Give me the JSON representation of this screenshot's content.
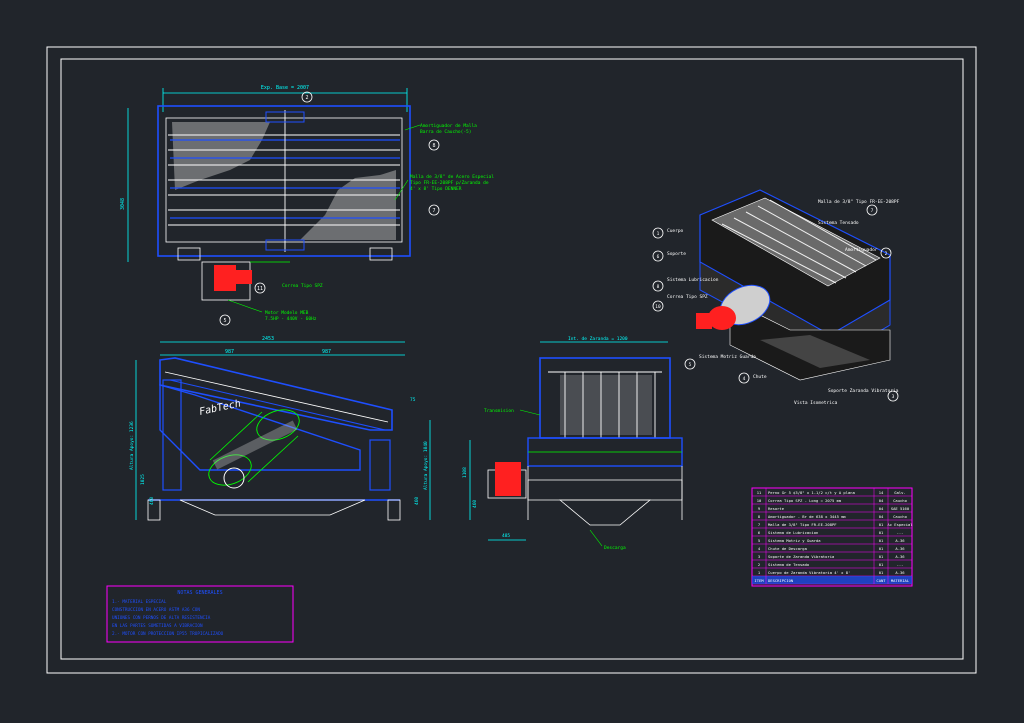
{
  "colors": {
    "background": "#21252b",
    "frame": "#ffffff",
    "geometry": "#1e4fff",
    "dimension": "#00ffff",
    "note": "#00ff00",
    "hatch": "#c8c8c8",
    "motor": "#ff2020",
    "table": "#ff00ff",
    "label": "#ffffff",
    "dark": "#101010"
  },
  "top_view": {
    "dim_width": "Exp. Base = 2007",
    "dim_height": "3048",
    "callout_top": "2",
    "note_damper": [
      "Amortiguador de Malla",
      "Barra de Caucho(-5)"
    ],
    "note_mesh": [
      "Malla de 3/8\" de Acero Especial",
      "Tipo FR-EE-208PF p/Zaranda de",
      "4' x 8'  Tipo DENNER"
    ],
    "note_belt": "Correa Tipo SPZ",
    "note_motor": [
      "Motor Modelo MEB",
      "7.5HP - 440V - 60Hz"
    ],
    "callouts": [
      "8",
      "7",
      "11",
      "5"
    ]
  },
  "side_view": {
    "dim_total": "2453",
    "dim_left": "987",
    "dim_right": "987",
    "dim_height_left": "Altura Apoyo: 1236",
    "dim_mid": "1025",
    "dim_base": "460",
    "dim_height_right": "Altura Apoyo: 1040",
    "dim_right_2": "460",
    "dim_top_right": "75",
    "brand": "FabTech"
  },
  "front_view": {
    "dim_top": "Int. de Zaranda = 1200",
    "label_transmission": "Transmision",
    "label_discharge": "Descarga",
    "dim_bottom": "485",
    "dim_height": "1108",
    "dim_base": "460"
  },
  "iso_view": {
    "labels": [
      {
        "n": "1",
        "text": "Cuerpo"
      },
      {
        "n": "6",
        "text": "Soporte"
      },
      {
        "n": "8",
        "text": "Sistema Lubricacion"
      },
      {
        "n": "10",
        "text": "Correa Tipo SPZ"
      },
      {
        "n": "5",
        "text": "Sistema Motriz Guarda"
      },
      {
        "n": "4",
        "text": "Chute"
      },
      {
        "n": "7",
        "text": "Malla de 3/8\" Tipo FR-EE-208PF"
      },
      {
        "n": "9",
        "text": "Sistema Tensado"
      },
      {
        "n": "2",
        "text": "Amortiguador"
      },
      {
        "n": "3",
        "text": "Soporte Zaranda Vibratoria"
      }
    ],
    "caption": "Vista Isometrica"
  },
  "notes": {
    "title": "NOTAS GENERALES",
    "lines": [
      "1.- MATERIAL ESPECIAL",
      "   CONSTRUCCION EN ACERO ASTM A36 CON",
      "   UNIONES CON PERNOS DE ALTA RESISTENCIA",
      "   EN LAS PARTES SOMETIDAS A VIBRACION",
      "2.- MOTOR CON PROTECCION IP55 TROPICALIZADO"
    ]
  },
  "parts_table": {
    "rows": [
      [
        "11",
        "Perno Gr 5 ¢3/8\" x 1-1/2 c/t y A plana",
        "14",
        "Galv."
      ],
      [
        "10",
        "Correa Tipo SPZ  -  Long = 2075 mm",
        "04",
        "Caucho"
      ],
      [
        "9",
        "Resorte",
        "04",
        "SAE 5160"
      ],
      [
        "8",
        "Amortiguador  -  Br de 638 x 3445 mm",
        "04",
        "Caucho"
      ],
      [
        "7",
        "Malla de 3/8\"  Tipo FR-EE-208PF",
        "01",
        "Ac Especial"
      ],
      [
        "6",
        "Sistema de Lubricacion",
        "01",
        "---"
      ],
      [
        "5",
        "Sistema Motriz y Guarda",
        "01",
        "A-36"
      ],
      [
        "4",
        "Chute de Descarga",
        "01",
        "A-36"
      ],
      [
        "3",
        "Soporte de Zaranda Vibratoria",
        "01",
        "A-36"
      ],
      [
        "2",
        "Sistema de Tensado",
        "01",
        "---"
      ],
      [
        "1",
        "Cuerpo de Zaranda Vibratoria  4' x 8'",
        "01",
        "A-36"
      ]
    ],
    "header": [
      "ITEM",
      "DESCRIPCION",
      "CANT",
      "MATERIAL"
    ]
  }
}
